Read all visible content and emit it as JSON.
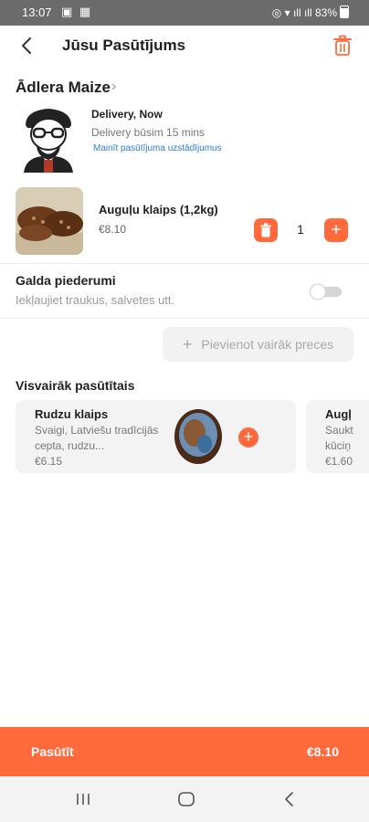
{
  "status_bar": {
    "time": "13:07",
    "battery": "83%"
  },
  "header": {
    "title": "Jūsu Pasūtījums"
  },
  "store": {
    "name": "Ādlera Maize",
    "delivery_mode": "Delivery, Now",
    "delivery_eta": "Delivery būsim 15 mins",
    "change_settings": "Mainīt pasūtījuma uzstādījumus"
  },
  "cart": {
    "items": [
      {
        "name": "Auguļu klaips (1,2kg)",
        "price": "€8.10",
        "quantity": "1"
      }
    ]
  },
  "cutlery": {
    "title": "Galda piederumi",
    "description": "Iekļaujiet traukus, salvetes utt.",
    "enabled": false
  },
  "add_more": {
    "label": "Pievienot vairāk preces"
  },
  "popular": {
    "title": "Visvairāk pasūtītais",
    "items": [
      {
        "name": "Rudzu klaips",
        "description": "Svaigi, Latviešu tradīcijās cepta, rudzu...",
        "price": "€6.15"
      },
      {
        "name": "Augļ",
        "description_line1": "Saukt",
        "description_line2": "kūciņ",
        "price": "€1.60"
      }
    ]
  },
  "order_bar": {
    "label": "Pasūtīt",
    "total": "€8.10"
  },
  "colors": {
    "accent": "#ff6a3d",
    "link": "#2d7dd2",
    "status_bar": "#6b6b6b"
  },
  "icons": [
    "back-arrow-icon",
    "trash-icon",
    "chevron-right-icon",
    "plus-icon",
    "recents-icon",
    "home-icon",
    "back-icon"
  ]
}
